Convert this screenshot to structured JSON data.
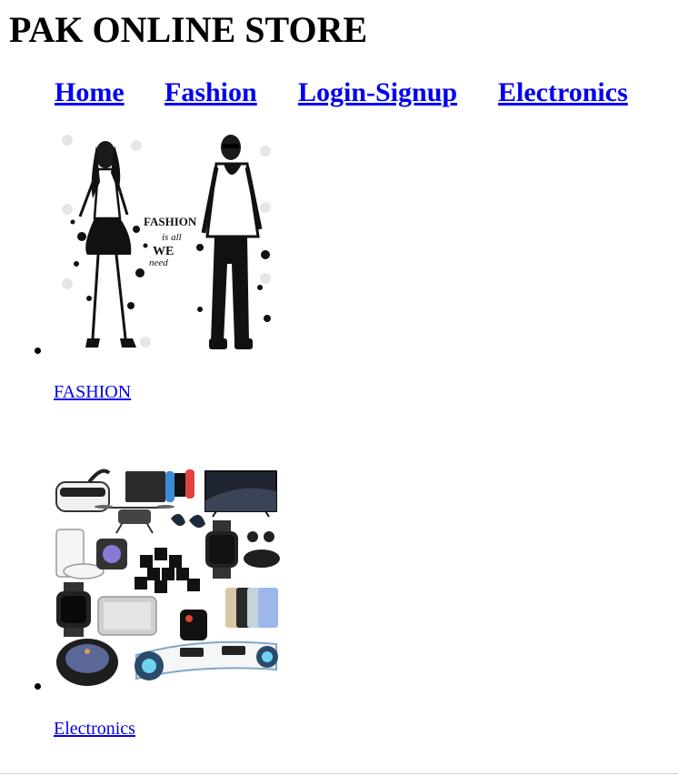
{
  "header": {
    "title": "PAK ONLINE STORE"
  },
  "nav": {
    "home": "Home",
    "fashion": "Fashion",
    "login_signup": "Login-Signup",
    "electronics": "Electronics"
  },
  "categories": [
    {
      "label": "FASHION",
      "image_text": {
        "line1": "FASHION",
        "line2": "is all",
        "line3": "WE",
        "line4": "need"
      }
    },
    {
      "label": "Electronics"
    }
  ],
  "colors": {
    "link": "#0000ee",
    "text": "#000000",
    "background": "#ffffff"
  }
}
